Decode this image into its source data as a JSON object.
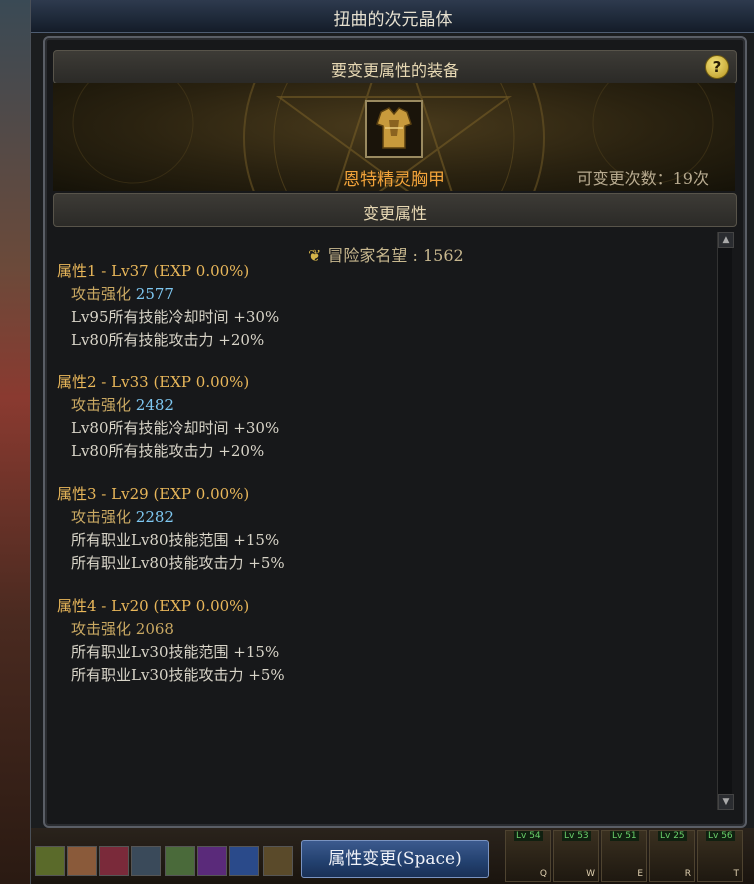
{
  "window": {
    "title": "扭曲的次元晶体"
  },
  "header": {
    "title": "要变更属性的装备",
    "help_glyph": "?"
  },
  "equipment": {
    "name": "恩特精灵胸甲",
    "change_count": "可变更次数：19次",
    "name_color": "#f2a33a"
  },
  "section": {
    "title": "变更属性"
  },
  "fame": {
    "label": "冒险家名望 : 1562",
    "icon": "fame-crest-icon"
  },
  "attributes": [
    {
      "title": "属性1 - Lv37 (EXP 0.00%)",
      "strength_label": "攻击强化",
      "strength_value": "2577",
      "effects": [
        "Lv95所有技能冷却时间 +30%",
        "Lv80所有技能攻击力 +20%"
      ]
    },
    {
      "title": "属性2 - Lv33 (EXP 0.00%)",
      "strength_label": "攻击强化",
      "strength_value": "2482",
      "effects": [
        "Lv80所有技能冷却时间 +30%",
        "Lv80所有技能攻击力 +20%"
      ]
    },
    {
      "title": "属性3 - Lv29 (EXP 0.00%)",
      "strength_label": "攻击强化",
      "strength_value": "2282",
      "effects": [
        "所有职业Lv80技能范围 +15%",
        "所有职业Lv80技能攻击力 +5%"
      ]
    },
    {
      "title": "属性4 - Lv20 (EXP 0.00%)",
      "strength_label": "攻击强化",
      "strength_value": "2068",
      "effects": [
        "所有职业Lv30技能范围 +15%",
        "所有职业Lv30技能攻击力 +5%"
      ]
    }
  ],
  "scrollbar": {
    "up_glyph": "▲",
    "down_glyph": "▼"
  },
  "bottom": {
    "change_button": "属性变更(Space)",
    "skills": [
      {
        "lv": "Lv 54",
        "key": "Q"
      },
      {
        "lv": "Lv 53",
        "key": "W"
      },
      {
        "lv": "Lv 51",
        "key": "E"
      },
      {
        "lv": "Lv 25",
        "key": "R"
      },
      {
        "lv": "Lv 56",
        "key": "T"
      }
    ]
  },
  "colors": {
    "accent_gold": "#e9b75a",
    "value_blue": "#7fc8f2",
    "button_blue": "#22406e"
  }
}
